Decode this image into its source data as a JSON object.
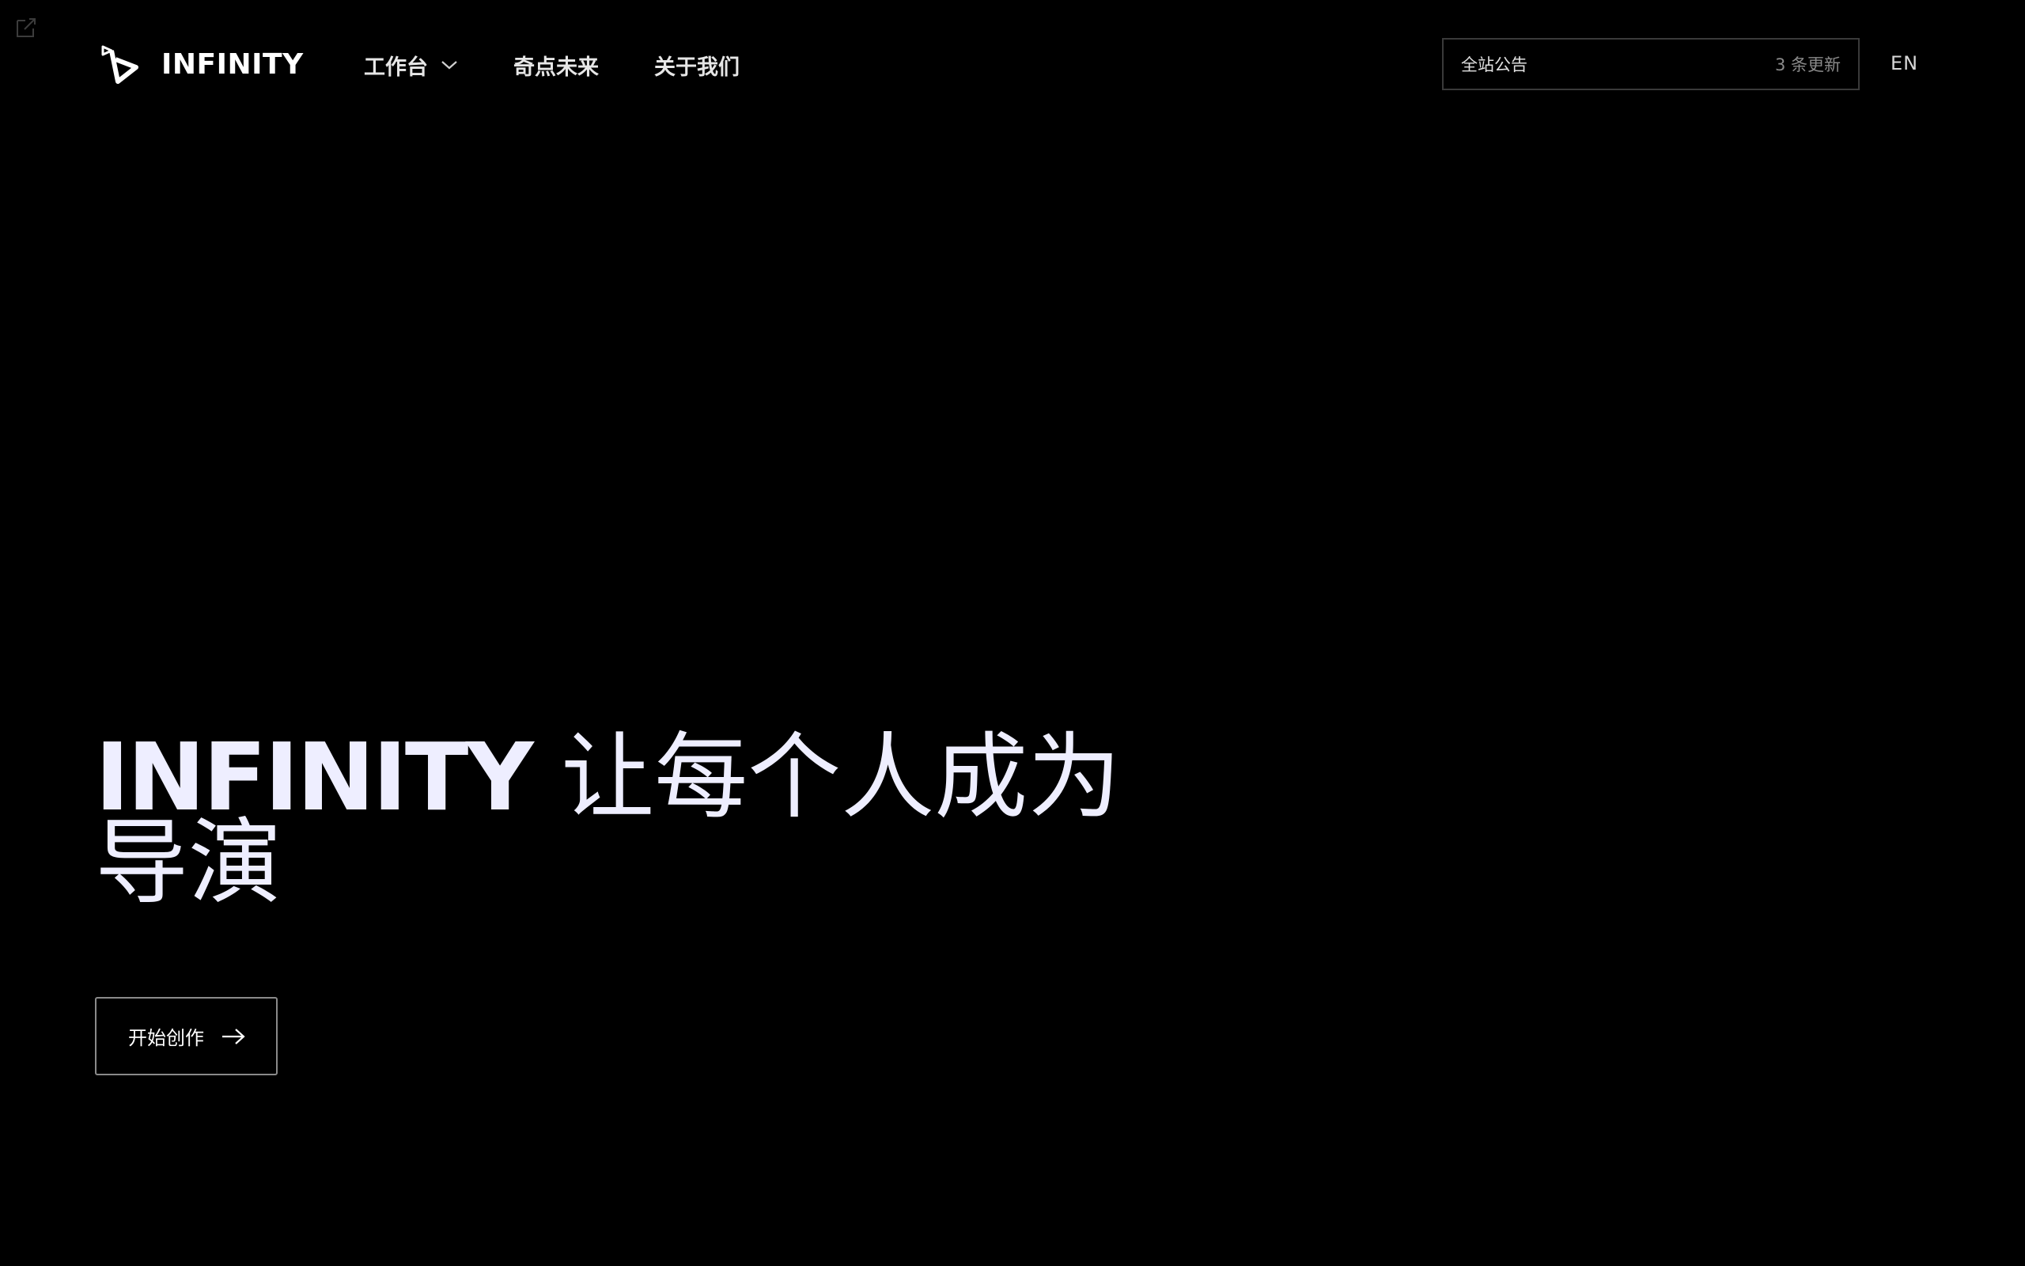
{
  "brand": {
    "name": "INFINITY"
  },
  "nav": {
    "items": [
      {
        "label": "工作台",
        "has_dropdown": true
      },
      {
        "label": "奇点未来",
        "has_dropdown": false
      },
      {
        "label": "关于我们",
        "has_dropdown": false
      }
    ]
  },
  "announcement": {
    "title": "全站公告",
    "count": "3 条更新"
  },
  "language_toggle": "EN",
  "hero": {
    "brand": "INFINITY",
    "tagline": "让每个人成为导演"
  },
  "cta": {
    "label": "开始创作"
  },
  "icons": {
    "corner": "external-link-icon",
    "logo": "logo-mark-icon",
    "dropdown": "chevron-down-icon",
    "cta": "arrow-right-icon"
  },
  "colors": {
    "background": "#000000",
    "text": "#ffffff",
    "hero_text": "#eeeeff",
    "border": "#3a3a3a",
    "muted": "#8a8a8a"
  }
}
